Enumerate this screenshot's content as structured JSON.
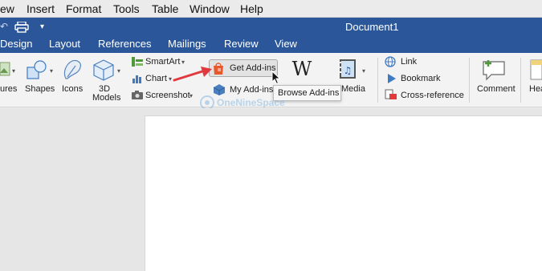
{
  "menubar": {
    "items": [
      "ew",
      "Insert",
      "Format",
      "Tools",
      "Table",
      "Window",
      "Help"
    ]
  },
  "titlebar": {
    "title": "Document1"
  },
  "tabs": [
    "Design",
    "Layout",
    "References",
    "Mailings",
    "Review",
    "View"
  ],
  "ribbon": {
    "pictures_label": "ures",
    "shapes_label": "Shapes",
    "icons_label": "Icons",
    "models_label_1": "3D",
    "models_label_2": "Models",
    "smartart_label": "SmartArt",
    "chart_label": "Chart",
    "screenshot_label": "Screenshot",
    "get_addins_label": "Get Add-ins",
    "my_addins_label": "My Add-ins",
    "media_label": "Media",
    "link_label": "Link",
    "bookmark_label": "Bookmark",
    "cross_reference_label": "Cross-reference",
    "comment_label": "Comment",
    "header_label": "Hea"
  },
  "tooltip": {
    "text": "Browse Add-ins"
  },
  "watermark": {
    "text": "OneNineSpace"
  },
  "colors": {
    "titlebar": "#2b579a",
    "arrow": "#e0393e",
    "addin_bag": "#e8582b"
  }
}
